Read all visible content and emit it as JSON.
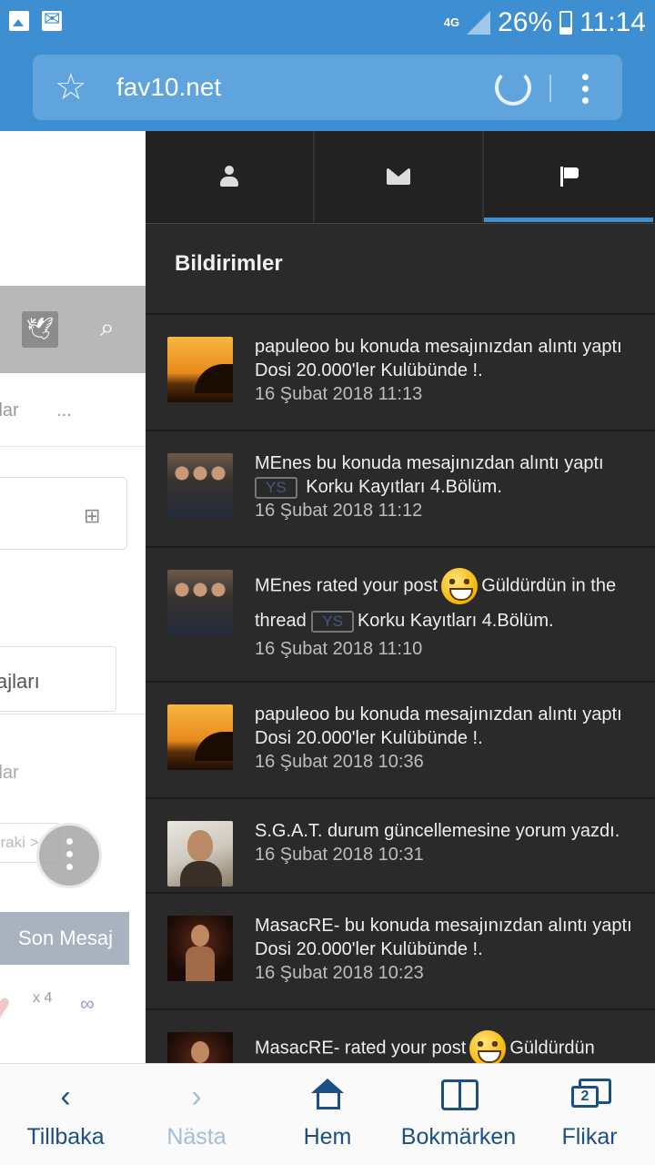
{
  "status_bar": {
    "network": "4G",
    "battery": "26%",
    "time": "11:14"
  },
  "browser": {
    "url": "fav10.net"
  },
  "background_page": {
    "nav_partial": "jlar",
    "nav_more": "...",
    "section_partial": "ajları",
    "list_partial": "jlar",
    "input_placeholder_partial": "nraki",
    "input_arrow": ">",
    "last_message_button": "Son Mesaj",
    "like_count": "x 4"
  },
  "panel": {
    "tabs": [
      {
        "icon": "user-icon",
        "active": false
      },
      {
        "icon": "mail-icon",
        "active": false
      },
      {
        "icon": "flag-icon",
        "active": true
      }
    ],
    "title": "Bildirimler",
    "notifications": [
      {
        "avatar": "sunset",
        "text": "papuleoo bu konuda mesajınızdan alıntı yaptı Dosi 20.000'ler Kulübünde !.",
        "date": "16 Şubat 2018 11:13"
      },
      {
        "avatar": "group",
        "text_before": "MEnes bu konuda mesajınızdan alıntı yaptı",
        "prefix": "YS",
        "text_after": "Korku Kayıtları 4.Bölüm.",
        "date": "16 Şubat 2018 11:12"
      },
      {
        "avatar": "group",
        "text_before": "MEnes rated your post",
        "rating": "Güldürdün",
        "text_mid": "in the thread",
        "prefix": "YS",
        "text_after": "Korku Kayıtları 4.Bölüm.",
        "date": "16 Şubat 2018 11:10"
      },
      {
        "avatar": "sunset",
        "text": "papuleoo bu konuda mesajınızdan alıntı yaptı Dosi 20.000'ler Kulübünde !.",
        "date": "16 Şubat 2018 10:36"
      },
      {
        "avatar": "man",
        "text": "S.G.A.T. durum güncellemesine yorum yazdı.",
        "date": "16 Şubat 2018 10:31"
      },
      {
        "avatar": "singer",
        "text": "MasacRE- bu konuda mesajınızdan alıntı yaptı Dosi 20.000'ler Kulübünde !.",
        "date": "16 Şubat 2018 10:23"
      },
      {
        "avatar": "singer",
        "text_before": "MasacRE- rated your post",
        "rating": "Güldürdün"
      }
    ]
  },
  "bottom_nav": {
    "back": "Tillbaka",
    "forward": "Nästa",
    "home": "Hem",
    "bookmarks": "Bokmärken",
    "tabs": "Flikar",
    "tab_count": "2"
  }
}
